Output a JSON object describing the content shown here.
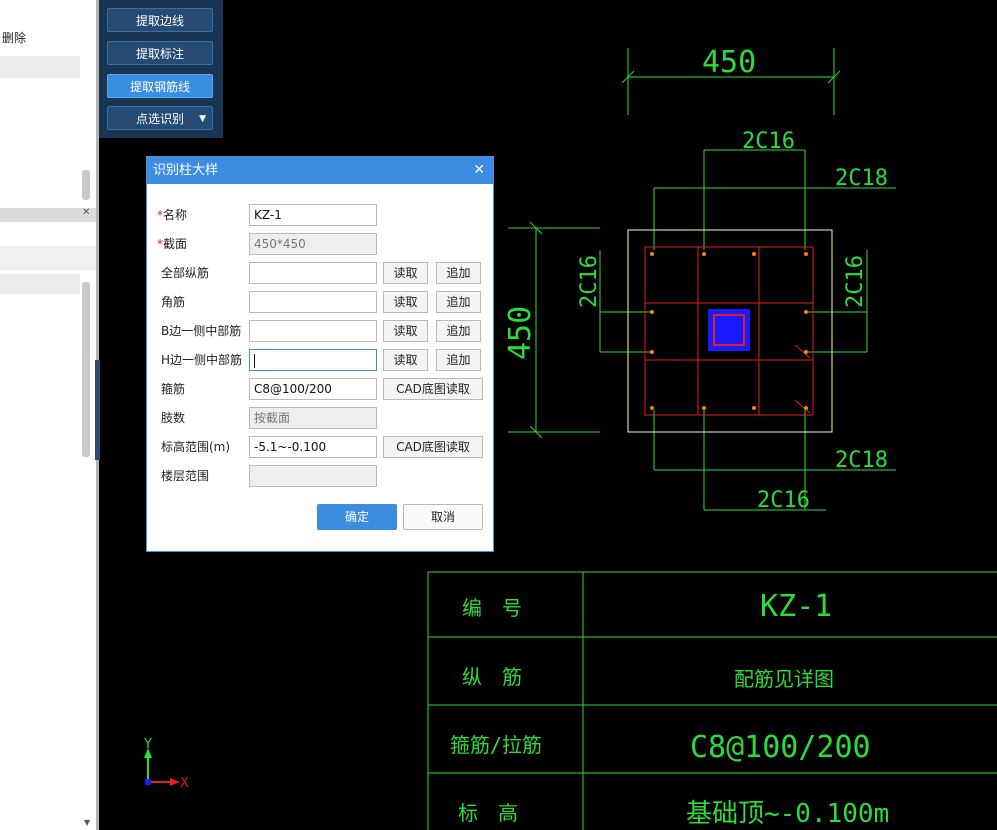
{
  "left_panel": {
    "delete_label": "删除"
  },
  "toolbar": {
    "extract_edge": "提取边线",
    "extract_label": "提取标注",
    "extract_rebar": "提取钢筋线",
    "point_identify": "点选识别"
  },
  "drawing": {
    "dim_top": "450",
    "dim_left": "450",
    "rebar_top": "2C16",
    "rebar_top_right": "2C18",
    "rebar_left": "2C16",
    "rebar_right": "2C16",
    "rebar_bottom_right": "2C18",
    "rebar_bottom": "2C16",
    "axis_x": "X",
    "axis_y": "Y"
  },
  "table": {
    "rows": [
      {
        "label": "编　号",
        "value": "KZ-1"
      },
      {
        "label": "纵　筋",
        "value": "配筋见详图"
      },
      {
        "label": "箍筋/拉筋",
        "value": "C8@100/200"
      },
      {
        "label": "标　高",
        "value": "基础顶~-0.100m"
      }
    ]
  },
  "dialog": {
    "title": "识别柱大样",
    "name_label": "名称",
    "name_value": "KZ-1",
    "section_label": "截面",
    "section_value": "450*450",
    "all_rebar_label": "全部纵筋",
    "corner_rebar_label": "角筋",
    "b_side_label": "B边一侧中部筋",
    "h_side_label": "H边一侧中部筋",
    "stirrup_label": "箍筋",
    "stirrup_value": "C8@100/200",
    "legs_label": "肢数",
    "legs_placeholder": "按截面",
    "elevation_label": "标高范围(m)",
    "elevation_value": "-5.1~-0.100",
    "floor_label": "楼层范围",
    "read_label": "读取",
    "append_label": "追加",
    "cad_read_label": "CAD底图读取",
    "ok_label": "确定",
    "cancel_label": "取消"
  },
  "colors": {
    "cad_green": "#2bdc3a",
    "cad_red": "#e02020",
    "cad_yellow": "#ffff99",
    "dialog_accent": "#3c8ce2",
    "toolbar_bg": "#1a3554"
  }
}
